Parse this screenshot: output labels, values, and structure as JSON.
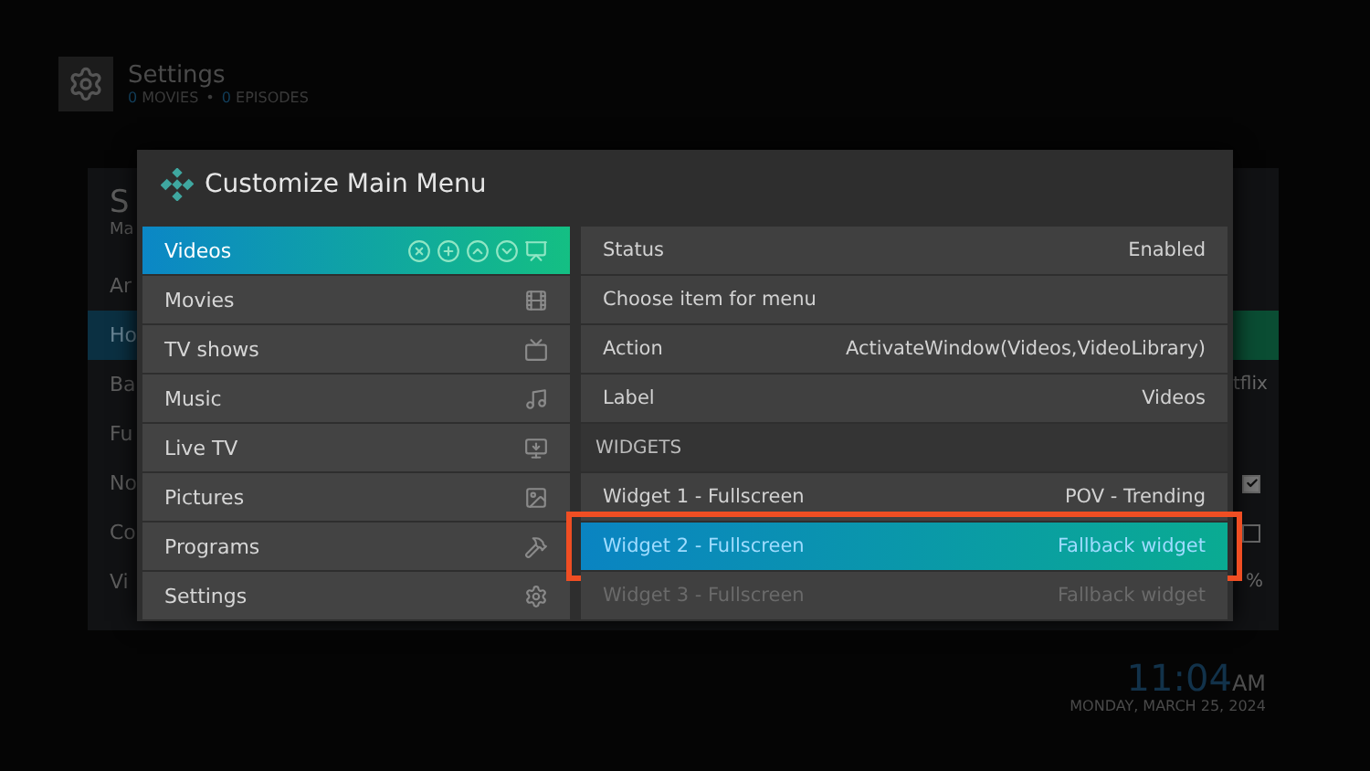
{
  "header": {
    "title": "Settings",
    "stats": [
      {
        "count": "0",
        "label": "MOVIES"
      },
      {
        "count": "0",
        "label": "EPISODES"
      }
    ],
    "separator": "•"
  },
  "background_panel": {
    "title": "S",
    "subtitle": "Ma",
    "rows": [
      {
        "label": "Ar",
        "selected": false
      },
      {
        "label": "Ho",
        "selected": true
      },
      {
        "label": "Ba",
        "value": "tflix",
        "selected": false
      },
      {
        "label": "Fu",
        "selected": false
      },
      {
        "label": "No",
        "checked": true,
        "selected": false
      },
      {
        "label": "Co",
        "checked": false,
        "selected": false
      },
      {
        "label": "Vi",
        "value": "%",
        "selected": false
      }
    ]
  },
  "dialog": {
    "title": "Customize Main Menu",
    "menu_items": [
      {
        "label": "Videos",
        "selected": true
      },
      {
        "label": "Movies",
        "selected": false
      },
      {
        "label": "TV shows",
        "selected": false
      },
      {
        "label": "Music",
        "selected": false
      },
      {
        "label": "Live TV",
        "selected": false
      },
      {
        "label": "Pictures",
        "selected": false
      },
      {
        "label": "Programs",
        "selected": false
      },
      {
        "label": "Settings",
        "selected": false
      }
    ],
    "properties": [
      {
        "kind": "row",
        "label": "Status",
        "value": "Enabled",
        "selected": false,
        "disabled": false,
        "outlined": false
      },
      {
        "kind": "row",
        "label": "Choose item for menu",
        "selected": false,
        "disabled": false,
        "outlined": false
      },
      {
        "kind": "row",
        "label": "Action",
        "value": "ActivateWindow(Videos,VideoLibrary)",
        "selected": false,
        "disabled": false,
        "outlined": false
      },
      {
        "kind": "row",
        "label": "Label",
        "value": "Videos",
        "selected": false,
        "disabled": false,
        "outlined": false
      },
      {
        "kind": "heading",
        "label": "WIDGETS"
      },
      {
        "kind": "row",
        "label": "Widget 1 - Fullscreen",
        "value": "POV - Trending",
        "selected": false,
        "disabled": false,
        "outlined": false
      },
      {
        "kind": "row",
        "label": "Widget 2 - Fullscreen",
        "value": "Fallback widget",
        "selected": true,
        "disabled": false,
        "outlined": true
      },
      {
        "kind": "row",
        "label": "Widget 3 - Fullscreen",
        "value": "Fallback widget",
        "selected": false,
        "disabled": true,
        "outlined": false
      }
    ]
  },
  "clock": {
    "time": "11:04",
    "meridiem": "AM",
    "date": "MONDAY, MARCH 25, 2024"
  }
}
